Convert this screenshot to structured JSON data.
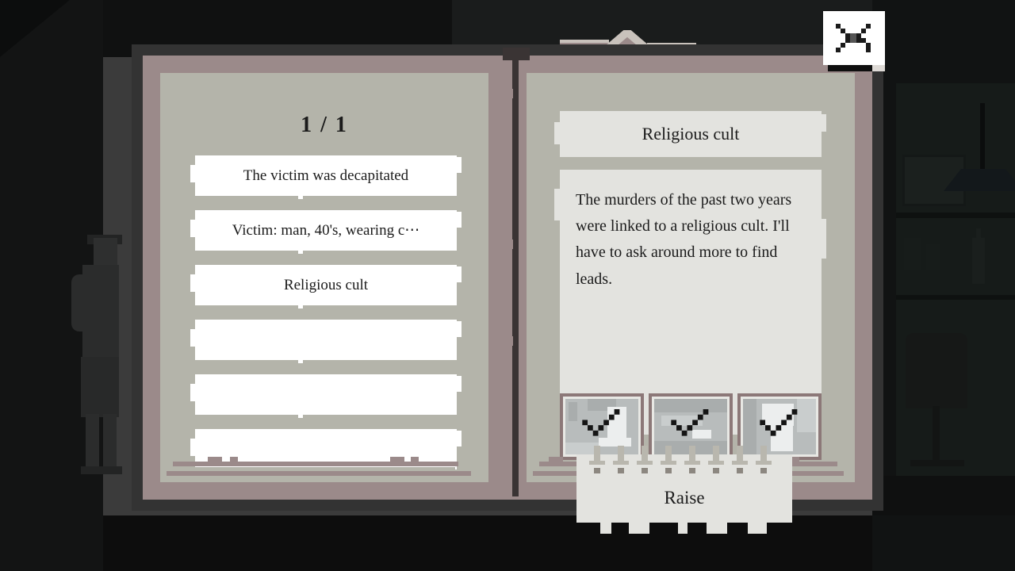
{
  "scene": {
    "background_color": "#161717",
    "wall_color": "#3b3b3b",
    "floor_color": "#0d0d0d"
  },
  "book": {
    "cover_color": "#333333",
    "border_color": "#9b8a8a",
    "page_color": "#b4b4aa",
    "panel_color": "#e3e3df",
    "card_color": "#ffffff"
  },
  "left_page": {
    "page_counter": "1 / 1",
    "clues": [
      {
        "label": "The victim was decapitated",
        "empty": false
      },
      {
        "label": "Victim: man, 40's, wearing c⋯",
        "empty": false
      },
      {
        "label": "Religious cult",
        "empty": false
      },
      {
        "label": "",
        "empty": true
      },
      {
        "label": "",
        "empty": true
      },
      {
        "label": "",
        "empty": true
      }
    ]
  },
  "right_page": {
    "title": "Religious cult",
    "body": "The murders of the past two years were linked to a religious cult. I'll have to ask around more to find leads.",
    "thumbnails": [
      {
        "name": "evidence-thumbnail-1",
        "checked": true
      },
      {
        "name": "evidence-thumbnail-2",
        "checked": true
      },
      {
        "name": "evidence-thumbnail-3",
        "checked": true
      }
    ],
    "thumb_border_color": "#8c7878"
  },
  "controls": {
    "raise_label": "Raise",
    "close_icon": "close-x-icon",
    "bookmark_icon": "bookmark-tab-icon"
  }
}
